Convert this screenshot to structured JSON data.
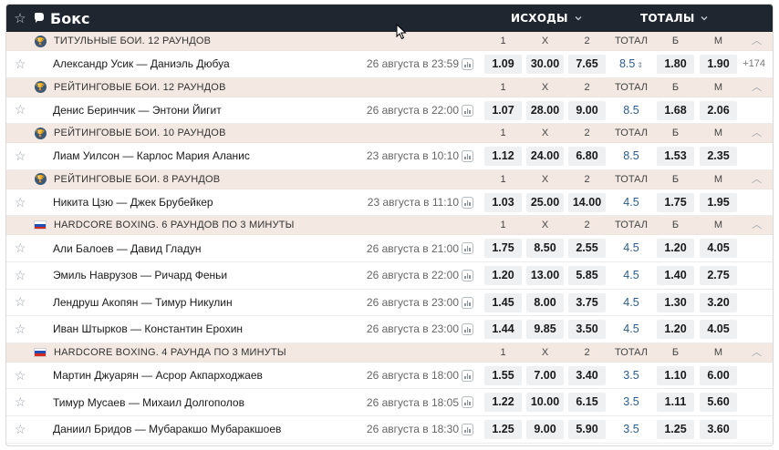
{
  "header": {
    "title": "Бокс",
    "outcomes_label": "ИСХОДЫ",
    "totals_label": "ТОТАЛЫ"
  },
  "columns": {
    "c1": "1",
    "cx": "X",
    "c2": "2",
    "total": "ТОТАЛ",
    "b": "Б",
    "m": "М"
  },
  "colors": {
    "topbar": "#1f2630",
    "group_bg": "#f3e8e2",
    "total_text": "#2b5c8a",
    "odd_bg": "#eef0f2",
    "trophy": "#3b5877"
  },
  "groups": [
    {
      "icon": "trophy-icon",
      "name": "ТИТУЛЬНЫЕ БОИ. 12 РАУНДОВ",
      "events": [
        {
          "name": "Александр Усик — Даниэль Дюбуа",
          "date": "26 августа в 23:59",
          "o1": "1.09",
          "ox": "30.00",
          "o2": "7.65",
          "total": "8.5",
          "b": "1.80",
          "m": "1.90",
          "more": "+174",
          "total_arrows": true
        }
      ]
    },
    {
      "icon": "trophy-icon",
      "name": "РЕЙТИНГОВЫЕ БОИ. 12 РАУНДОВ",
      "events": [
        {
          "name": "Денис Беринчик — Энтони Йигит",
          "date": "26 августа в 22:00",
          "o1": "1.07",
          "ox": "28.00",
          "o2": "9.00",
          "total": "8.5",
          "b": "1.68",
          "m": "2.06"
        }
      ]
    },
    {
      "icon": "trophy-icon",
      "name": "РЕЙТИНГОВЫЕ БОИ. 10 РАУНДОВ",
      "events": [
        {
          "name": "Лиам Уилсон — Карлос Мария Аланис",
          "date": "23 августа в 10:10",
          "o1": "1.12",
          "ox": "24.00",
          "o2": "6.80",
          "total": "8.5",
          "b": "1.53",
          "m": "2.35"
        }
      ]
    },
    {
      "icon": "trophy-icon",
      "name": "РЕЙТИНГОВЫЕ БОИ. 8 РАУНДОВ",
      "events": [
        {
          "name": "Никита Цзю — Джек Брубейкер",
          "date": "23 августа в 11:10",
          "o1": "1.03",
          "ox": "25.00",
          "o2": "14.00",
          "total": "4.5",
          "b": "1.75",
          "m": "1.95"
        }
      ]
    },
    {
      "icon": "russia-flag-icon",
      "name": "HARDCORE BOXING. 6 РАУНДОВ ПО 3 МИНУТЫ",
      "events": [
        {
          "name": "Али Балоев — Давид Гладун",
          "date": "26 августа в 21:00",
          "o1": "1.75",
          "ox": "8.50",
          "o2": "2.55",
          "total": "4.5",
          "b": "1.20",
          "m": "4.05"
        },
        {
          "name": "Эмиль Наврузов — Ричард Феньи",
          "date": "26 августа в 22:00",
          "o1": "1.20",
          "ox": "13.00",
          "o2": "5.85",
          "total": "4.5",
          "b": "1.40",
          "m": "2.75"
        },
        {
          "name": "Лендруш Акопян — Тимур Никулин",
          "date": "26 августа в 23:00",
          "o1": "1.45",
          "ox": "8.00",
          "o2": "3.75",
          "total": "4.5",
          "b": "1.30",
          "m": "3.20"
        },
        {
          "name": "Иван Штырков — Константин Ерохин",
          "date": "26 августа в 23:00",
          "o1": "1.44",
          "ox": "9.85",
          "o2": "3.50",
          "total": "4.5",
          "b": "1.20",
          "m": "4.05"
        }
      ]
    },
    {
      "icon": "russia-flag-icon",
      "name": "HARDCORE BOXING. 4 РАУНДА ПО 3 МИНУТЫ",
      "events": [
        {
          "name": "Мартин Джуарян — Асрор Акпарходжаев",
          "date": "26 августа в 18:00",
          "o1": "1.55",
          "ox": "7.00",
          "o2": "3.40",
          "total": "3.5",
          "b": "1.10",
          "m": "6.00"
        },
        {
          "name": "Тимур Мусаев — Михаил Долгополов",
          "date": "26 августа в 18:05",
          "o1": "1.22",
          "ox": "10.00",
          "o2": "6.15",
          "total": "3.5",
          "b": "1.11",
          "m": "5.60"
        },
        {
          "name": "Даниил Бридов — Мубаракшо Мубаракшоев",
          "date": "26 августа в 18:30",
          "o1": "1.25",
          "ox": "9.00",
          "o2": "5.90",
          "total": "3.5",
          "b": "1.25",
          "m": "3.60"
        }
      ]
    }
  ]
}
